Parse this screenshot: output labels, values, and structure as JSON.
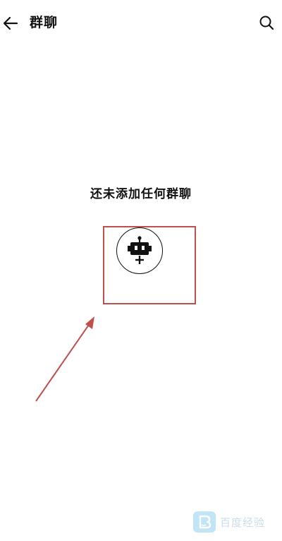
{
  "header": {
    "title": "群聊",
    "back_icon": "arrow-left-icon",
    "search_icon": "search-icon"
  },
  "empty_state": {
    "message": "还未添加任何群聊",
    "add_icon": "robot-add-icon"
  },
  "annotation": {
    "highlight_color": "#c0504d"
  },
  "watermark": {
    "text": "百度经验",
    "badge_color": "#4fb6e8"
  }
}
